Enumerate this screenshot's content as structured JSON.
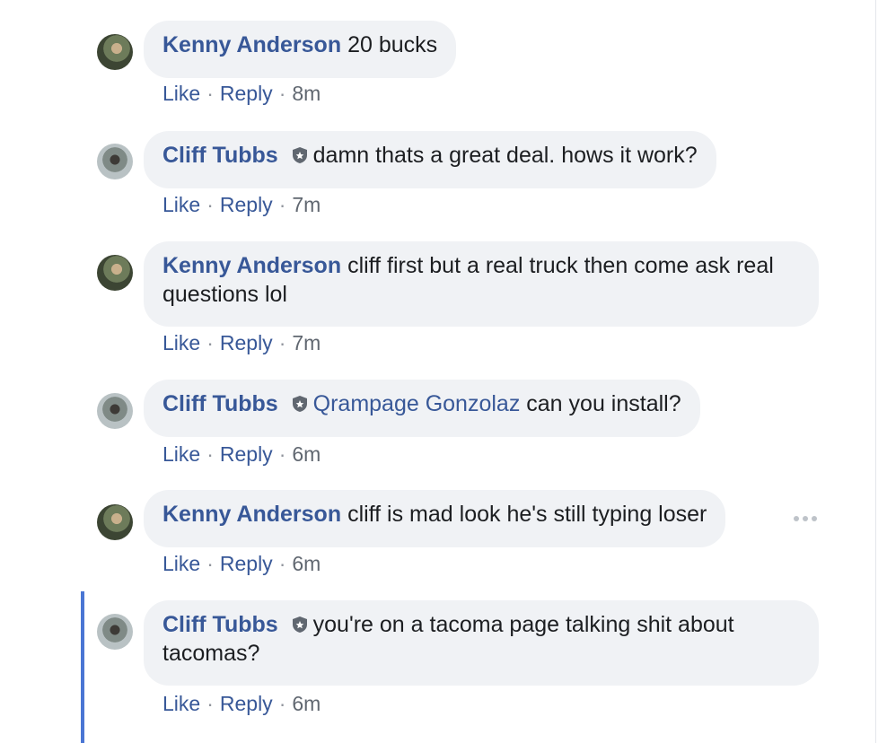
{
  "comments": [
    {
      "author": "Kenny Anderson",
      "mention": "",
      "text": "20 bucks",
      "actions": {
        "like": "Like",
        "reply": "Reply",
        "time": "8m"
      }
    },
    {
      "author": "Cliff Tubbs",
      "mention": "",
      "text": "damn thats a great deal. hows it work?",
      "actions": {
        "like": "Like",
        "reply": "Reply",
        "time": "7m"
      }
    },
    {
      "author": "Kenny Anderson",
      "mention": "",
      "text": "cliff first but a real truck then come ask real questions lol",
      "actions": {
        "like": "Like",
        "reply": "Reply",
        "time": "7m"
      }
    },
    {
      "author": "Cliff Tubbs",
      "mention": "Qrampage Gonzolaz",
      "text": "can you install?",
      "actions": {
        "like": "Like",
        "reply": "Reply",
        "time": "6m"
      }
    },
    {
      "author": "Kenny Anderson",
      "mention": "",
      "text": "cliff is mad look he's still typing loser",
      "actions": {
        "like": "Like",
        "reply": "Reply",
        "time": "6m"
      }
    },
    {
      "author": "Cliff Tubbs",
      "mention": "",
      "text": "you're on a tacoma page talking shit about tacomas?",
      "actions": {
        "like": "Like",
        "reply": "Reply",
        "time": "6m"
      }
    }
  ],
  "icons": {
    "badge": "shield-badge-icon",
    "more": "more-options-icon"
  },
  "colors": {
    "author_link": "#385898",
    "bubble_bg": "#f0f2f5",
    "highlight_bar": "#4a76d4"
  }
}
